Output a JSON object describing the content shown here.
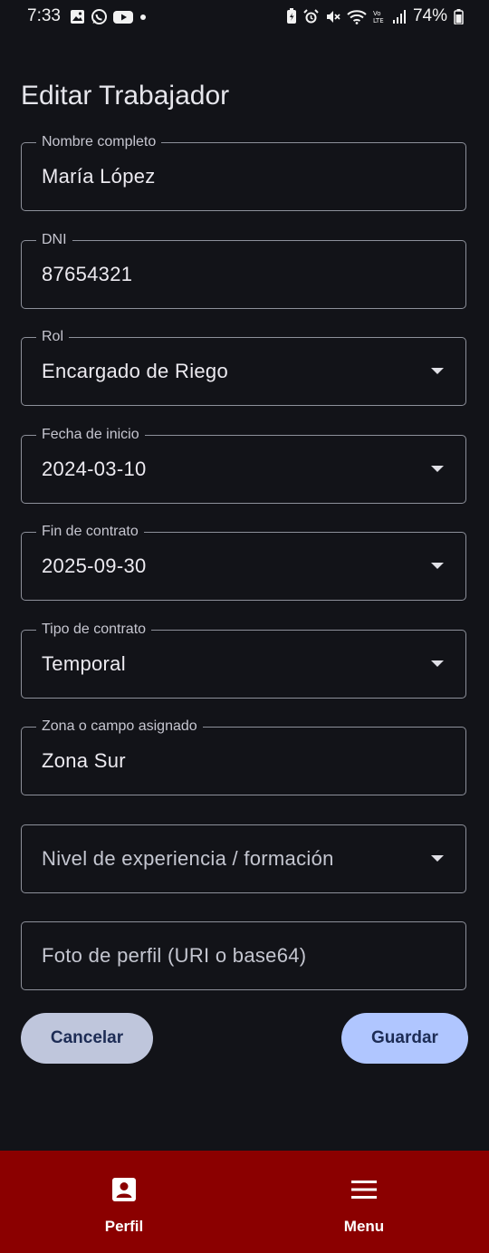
{
  "status_bar": {
    "time": "7:33",
    "battery": "74%",
    "left_icons": [
      "gallery-icon",
      "whatsapp-icon",
      "youtube-icon",
      "dot-icon"
    ],
    "right_icons": [
      "battery-saver-icon",
      "alarm-icon",
      "mute-icon",
      "wifi-icon",
      "volte-icon",
      "signal-icon",
      "battery-icon"
    ]
  },
  "page": {
    "title": "Editar Trabajador"
  },
  "form": {
    "fields": [
      {
        "label": "Nombre completo",
        "value": "María López"
      },
      {
        "label": "DNI",
        "value": "87654321"
      },
      {
        "label": "Rol",
        "value": "Encargado de Riego"
      },
      {
        "label": "Fecha de inicio",
        "value": "2024-03-10"
      },
      {
        "label": "Fin de contrato",
        "value": "2025-09-30"
      },
      {
        "label": "Tipo de contrato",
        "value": "Temporal"
      },
      {
        "label": "Zona o campo asignado",
        "value": "Zona Sur"
      },
      {
        "placeholder": "Nivel de experiencia / formación"
      },
      {
        "placeholder": "Foto de perfil (URI o base64)"
      }
    ]
  },
  "actions": {
    "cancel": "Cancelar",
    "save": "Guardar"
  },
  "bottom_nav": {
    "items": [
      {
        "label": "Perfil",
        "icon": "profile-icon"
      },
      {
        "label": "Menu",
        "icon": "menu-icon"
      }
    ]
  },
  "colors": {
    "background": "#121318",
    "bottom_nav": "#8b0000",
    "cancel_button": "#bfc6dc",
    "save_button": "#b0c6ff"
  }
}
